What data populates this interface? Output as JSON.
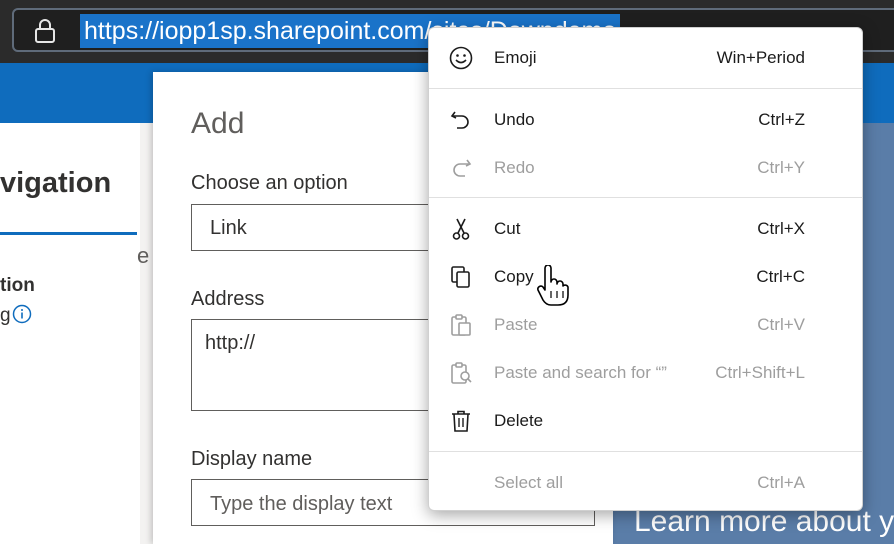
{
  "browser": {
    "url": "https://iopp1sp.sharepoint.com/sites/Downdemo"
  },
  "nav": {
    "title": "vigation",
    "item": "tion",
    "subitem": "g"
  },
  "add_panel": {
    "title": "Add",
    "choose_label": "Choose an option",
    "choose_value": "Link",
    "address_label": "Address",
    "address_value": "http://",
    "display_label": "Display name",
    "display_placeholder": "Type the display text",
    "partial_char": "e"
  },
  "background": {
    "learn_more": "Learn more about y"
  },
  "context_menu": {
    "emoji": {
      "label": "Emoji",
      "shortcut": "Win+Period"
    },
    "undo": {
      "label": "Undo",
      "shortcut": "Ctrl+Z"
    },
    "redo": {
      "label": "Redo",
      "shortcut": "Ctrl+Y"
    },
    "cut": {
      "label": "Cut",
      "shortcut": "Ctrl+X"
    },
    "copy": {
      "label": "Copy",
      "shortcut": "Ctrl+C"
    },
    "paste": {
      "label": "Paste",
      "shortcut": "Ctrl+V"
    },
    "paste_search": {
      "label": "Paste and search for “”",
      "shortcut": "Ctrl+Shift+L"
    },
    "delete": {
      "label": "Delete"
    },
    "select_all": {
      "label": "Select all",
      "shortcut": "Ctrl+A"
    }
  },
  "colors": {
    "url_highlight": "#1a73c9",
    "sharepoint_blue": "#0f6cbd",
    "disabled_text": "#9e9e9e"
  }
}
